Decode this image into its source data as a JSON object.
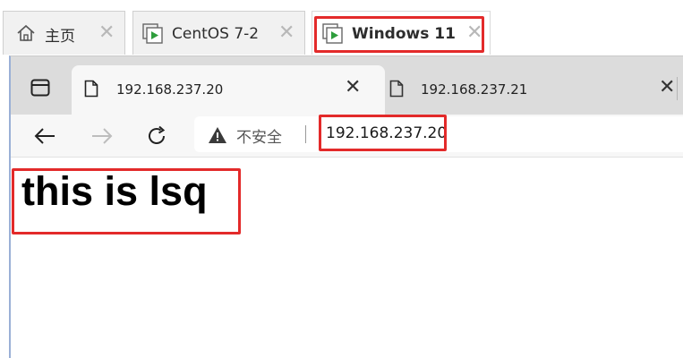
{
  "vmware": {
    "tabs": [
      {
        "label": "主页",
        "icon": "home-icon",
        "active": false
      },
      {
        "label": "CentOS 7-2",
        "icon": "vm-icon",
        "active": false
      },
      {
        "label": "Windows 11",
        "icon": "vm-icon",
        "active": true
      }
    ],
    "close_glyph": "✕"
  },
  "browser": {
    "tabs": [
      {
        "title": "192.168.237.20",
        "active": true
      },
      {
        "title": "192.168.237.21",
        "active": false
      }
    ],
    "close_glyph": "✕",
    "security_label": "不安全",
    "url": "192.168.237.20"
  },
  "page": {
    "heading": "this is lsq"
  },
  "colors": {
    "highlight": "#e32a2a",
    "vm_play": "#2e9d3c"
  }
}
